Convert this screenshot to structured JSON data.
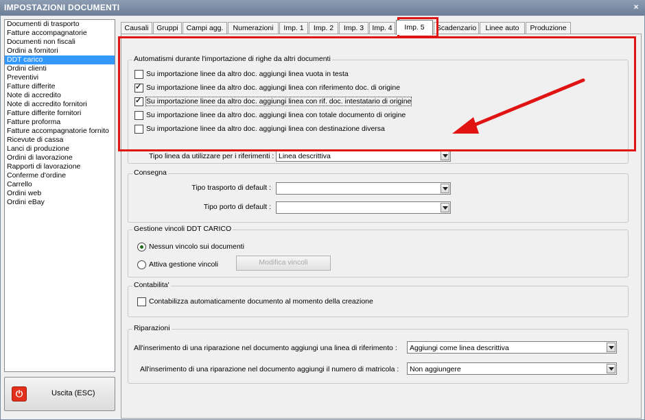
{
  "window": {
    "title": "IMPOSTAZIONI DOCUMENTI",
    "close_glyph": "×"
  },
  "sidebar": {
    "items": [
      "Documenti di trasporto",
      "Fatture accompagnatorie",
      "Documenti non fiscali",
      "Ordini a fornitori",
      "DDT carico",
      "Ordini clienti",
      "Preventivi",
      "Fatture differite",
      "Note di accredito",
      "Note di accredito fornitori",
      "Fatture differite fornitori",
      "Fatture proforma",
      "Fatture accompagnatorie fornito",
      "Ricevute di cassa",
      "Lanci di produzione",
      "Ordini di lavorazione",
      "Rapporti di lavorazione",
      "Conferme d'ordine",
      "Carrello",
      "Ordini web",
      "Ordini eBay"
    ],
    "selected_index": 4
  },
  "exit_button": {
    "label": "Uscita (ESC)",
    "icon": "power-icon",
    "icon_glyph": "⏻"
  },
  "tabs": [
    "Causali",
    "Gruppi",
    "Campi agg.",
    "Numerazioni",
    "Imp. 1",
    "Imp. 2",
    "Imp. 3",
    "Imp. 4",
    "Imp. 5",
    "Scadenzario",
    "Linee auto",
    "Produzione"
  ],
  "active_tab": "Imp. 5",
  "automatismi": {
    "legend": "Automatismi durante l'importazione di righe da altri documenti",
    "checks": [
      {
        "label": "Su importazione linee da altro doc. aggiungi linea vuota in testa",
        "checked": false
      },
      {
        "label": "Su importazione linee da altro doc. aggiungi linea con riferimento doc. di origine",
        "checked": true
      },
      {
        "label": "Su importazione linee da altro doc. aggiungi linea con rif. doc. intestatario di origine",
        "checked": true
      },
      {
        "label": "Su importazione linee da altro doc. aggiungi linea con totale documento di origine",
        "checked": false
      },
      {
        "label": "Su importazione linee da altro doc. aggiungi linea con destinazione diversa",
        "checked": false
      }
    ],
    "tipo_linea_label": "Tipo linea da utilizzare per i riferimenti :",
    "tipo_linea_value": "Linea descrittiva"
  },
  "consegna": {
    "legend": "Consegna",
    "tipo_trasporto_label": "Tipo trasporto di default :",
    "tipo_trasporto_value": "",
    "tipo_porto_label": "Tipo porto di default :",
    "tipo_porto_value": ""
  },
  "vincoli": {
    "legend": "Gestione vincoli DDT CARICO",
    "option1": "Nessun vincolo sui documenti",
    "option2": "Attiva gestione vincoli",
    "selected": 1,
    "modifica_label": "Modifica vincoli"
  },
  "contabilita": {
    "legend": "Contabilita'",
    "check_label": "Contabilizza automaticamente documento al momento della creazione",
    "checked": false
  },
  "riparazioni": {
    "legend": "Riparazioni",
    "label1": "All'inserimento di una riparazione nel documento aggiungi una linea di riferimento :",
    "value1": "Aggiungi come linea descrittiva",
    "label2": "All'inserimento di una riparazione nel documento aggiungi il numero di matricola :",
    "value2": "Non aggiungere"
  },
  "colors": {
    "annotation_red": "#e11414",
    "selection_blue": "#3399ff"
  }
}
